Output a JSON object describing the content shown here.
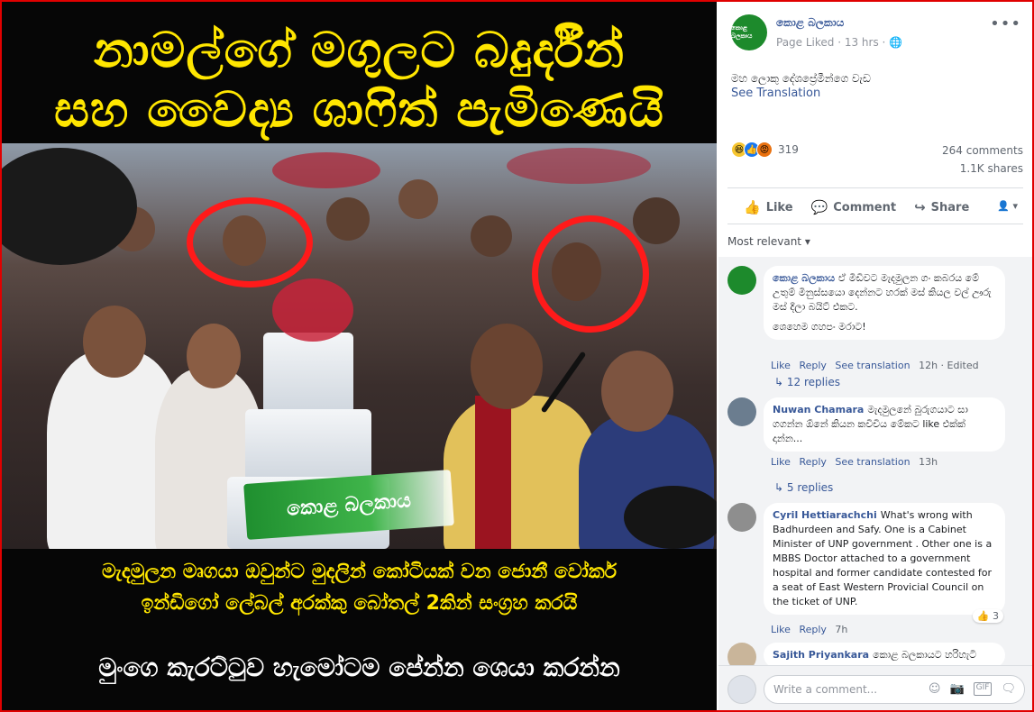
{
  "image": {
    "headline_line1": "නාමල්ගේ මගුලට බදුර්දීන්",
    "headline_line2": "සහ වෛද්‍ය ශාෆිත් පැමිණෙයි",
    "logo_text": "කොළ බලකාය",
    "caption_line1": "මැදමුලන මෘගයා ඔවුන්ට මුදලින් කෝටියක් වන ජොනී වෝකර්",
    "caption_line2": "ඉන්ඩිගෝ ලේබල් අරක්කු බෝතල් 2කින් සංග්‍රහ කරයි",
    "footer_line": "මුංගෙ කැරට්ටුව හැමෝටම පේන්න ශෙයා කරන්න"
  },
  "post": {
    "page_name": "කොළ බලකාය",
    "avatar_text": "කොළ බලකාය",
    "meta": "Page Liked · 13 hrs · 🌐",
    "more": "•••",
    "text": "මහ ලොකු දේශප්‍රේමීන්ගෙ වැඩ",
    "see_translation": "See Translation",
    "reaction_count": "319",
    "comments_count": "264 comments",
    "shares_count": "1.1K shares"
  },
  "actions": {
    "like": "Like",
    "comment": "Comment",
    "share": "Share",
    "audience": "▾"
  },
  "sort": {
    "label": "Most relevant ▾"
  },
  "comments": [
    {
      "author": "කොළ බලකාය",
      "text": "ඒ මිඩිවට මැදමුලන ගං කබරය මේ උතුම් මිනුස්සයො දෙන්නට හරක් මස් කියල වල් ඌරු මස් දීලා බයිට් එකට.",
      "text2": "ශෙහෙම ගහපං මරාට!",
      "meta_like": "Like",
      "meta_reply": "Reply",
      "meta_translation": "See translation",
      "meta_time": "12h · Edited",
      "replies": "12 replies"
    },
    {
      "author": "Nuwan Chamara",
      "text": "මැදමුලනේ බුරුගයාට සා ගගන්න ඕනේ කියන කවිචිය මේකට like එක්ක් දාන්න...",
      "meta_like": "Like",
      "meta_reply": "Reply",
      "meta_translation": "See translation",
      "meta_time": "13h",
      "replies": "5 replies"
    },
    {
      "author": "Cyril Hettiarachchi",
      "text": "What's wrong with Badhurdeen and Safy. One is a Cabinet Minister of UNP government . Other one is a MBBS Doctor attached to a government hospital and former candidate contested for a seat of East Western Provicial Council on the ticket of UNP.",
      "meta_like": "Like",
      "meta_reply": "Reply",
      "meta_time": "7h",
      "like_badge": "3"
    },
    {
      "author": "Sajith Priyankara",
      "text": "කොළ බලකායට හරිහැටි"
    }
  ],
  "composer": {
    "placeholder": "Write a comment...",
    "icons": [
      "emoji-icon",
      "camera-icon",
      "gif-icon",
      "sticker-icon"
    ]
  },
  "colors": {
    "frame": "#e00000",
    "headline": "#ffe600",
    "link": "#385898",
    "brand_green": "#1d8a2c"
  }
}
